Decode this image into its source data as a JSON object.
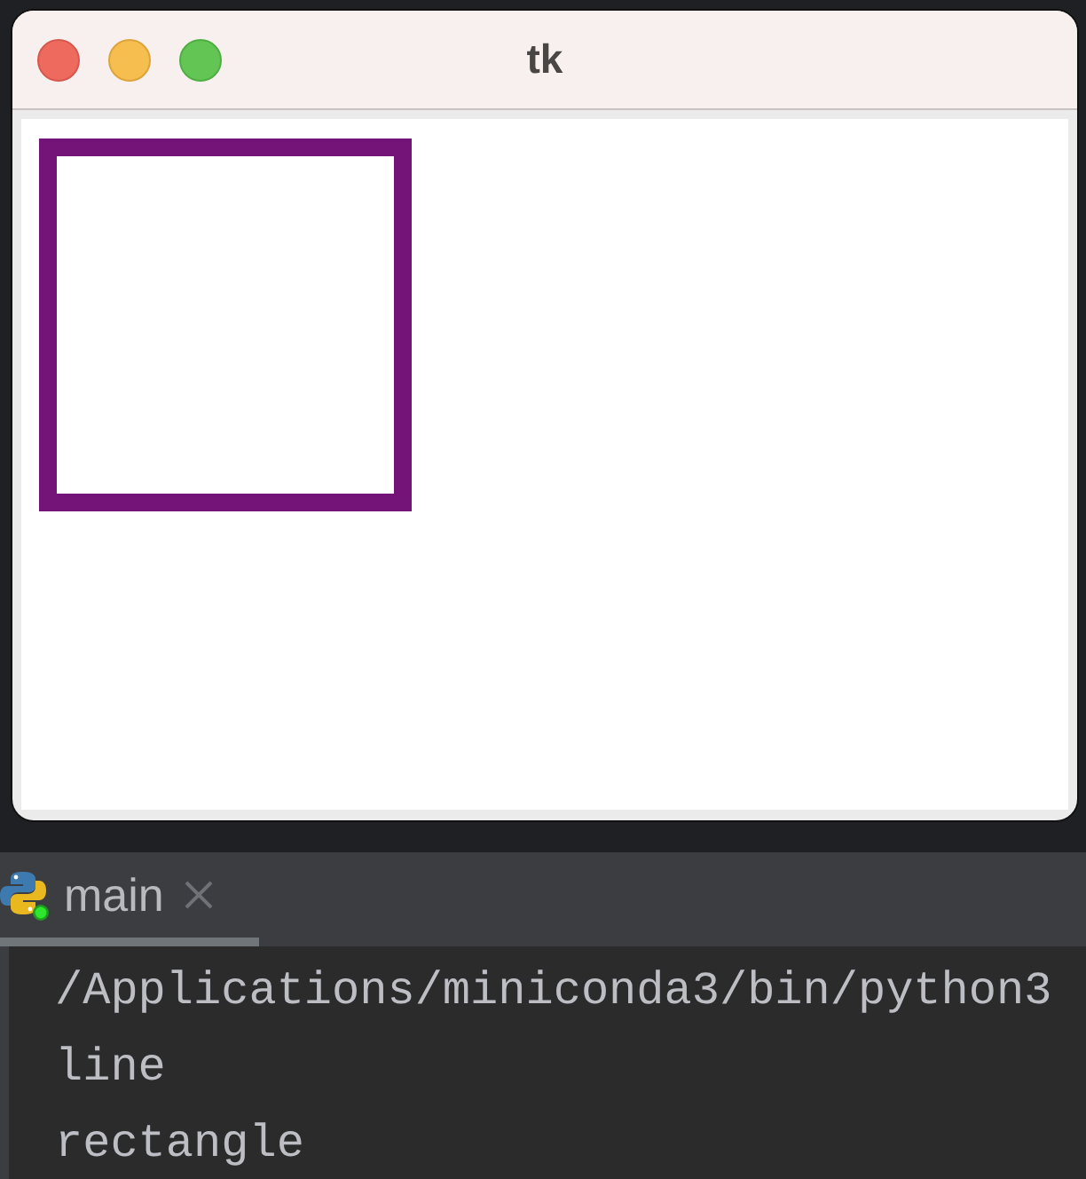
{
  "window": {
    "title": "tk",
    "canvas": {
      "shapes": [
        {
          "kind": "rectangle"
        }
      ]
    }
  },
  "run_panel": {
    "tabs": [
      {
        "label": "main",
        "selected": true
      }
    ],
    "console": {
      "lines": [
        "/Applications/miniconda3/bin/python3",
        "line",
        "rectangle"
      ]
    }
  }
}
